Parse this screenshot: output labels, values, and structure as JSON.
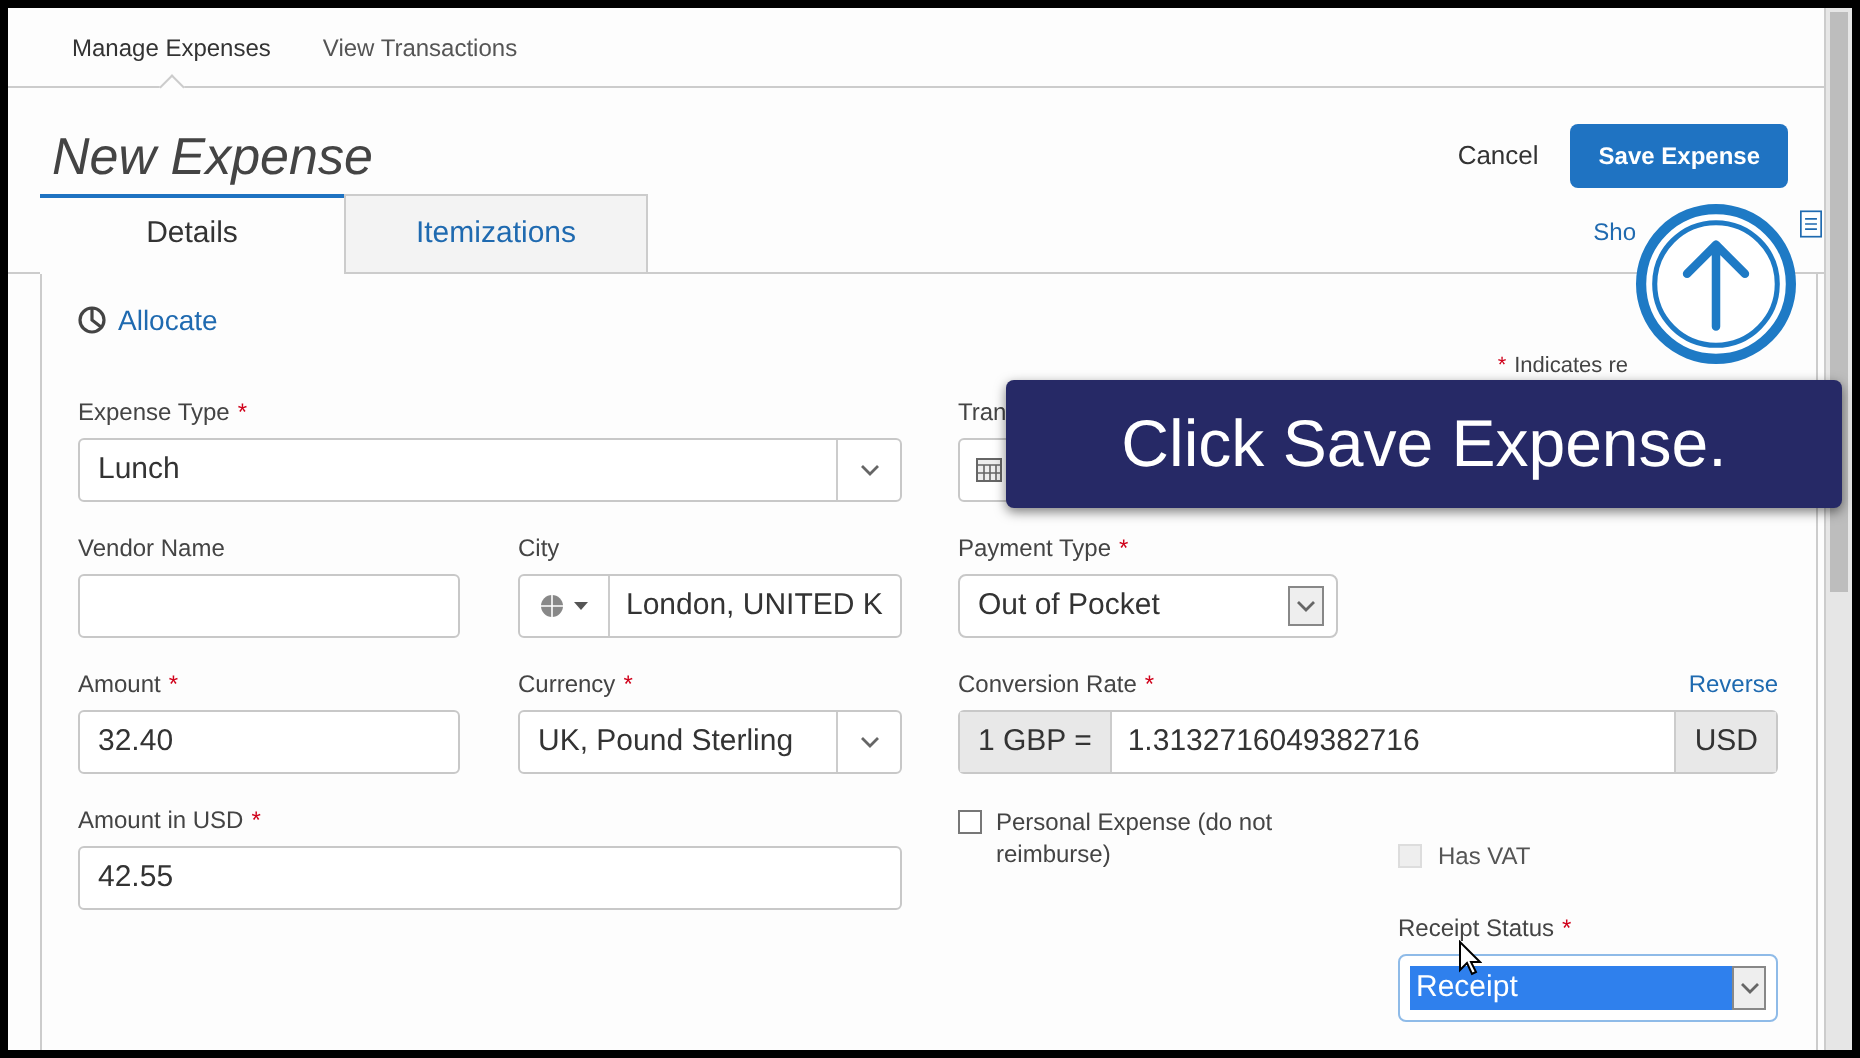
{
  "nav": [
    {
      "label": "Manage Expenses",
      "selected": true
    },
    {
      "label": "View Transactions",
      "selected": false
    }
  ],
  "title": "New Expense",
  "actions": {
    "cancel": "Cancel",
    "save": "Save Expense",
    "show_link": "Sho"
  },
  "tabs": [
    {
      "label": "Details",
      "selected": true
    },
    {
      "label": "Itemizations",
      "selected": false
    }
  ],
  "allocate": "Allocate",
  "required_mark": "*",
  "required_note": "Indicates re",
  "left": {
    "expense_type": {
      "label": "Expense Type",
      "required": true,
      "value": "Lunch"
    },
    "vendor_name": {
      "label": "Vendor Name",
      "required": false
    },
    "city": {
      "label": "City",
      "required": false,
      "value": "London, UNITED K"
    },
    "amount": {
      "label": "Amount",
      "required": true,
      "value": "32.40"
    },
    "currency": {
      "label": "Currency",
      "required": true,
      "value": "UK, Pound Sterling"
    },
    "amount_usd": {
      "label": "Amount in USD",
      "required": true,
      "value": "42.55"
    }
  },
  "right": {
    "transaction_date": {
      "label": "Tran"
    },
    "payment_type": {
      "label": "Payment Type",
      "required": true,
      "value": "Out of Pocket"
    },
    "conversion_rate": {
      "label": "Conversion Rate",
      "required": true,
      "prefix": "1 GBP =",
      "value": "1.3132716049382716",
      "suffix": "USD",
      "link": "Reverse"
    },
    "personal_expense": {
      "label": "Personal Expense (do not reimburse)",
      "checked": false
    },
    "has_vat": {
      "label": "Has VAT",
      "checked": false,
      "disabled": true
    },
    "receipt_status": {
      "label": "Receipt Status",
      "required": true,
      "value": "Receipt",
      "highlighted": true
    }
  },
  "callout": {
    "text": "Click Save Expense."
  }
}
